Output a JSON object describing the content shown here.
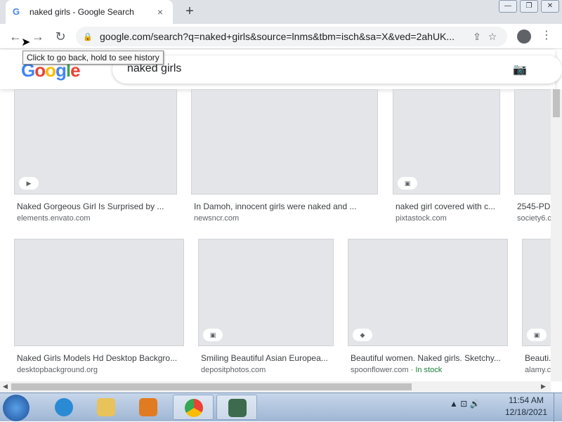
{
  "window": {
    "tab_title": "naked girls - Google Search",
    "tab_favicon": "G",
    "tab_close": "×",
    "new_tab": "+",
    "min": "—",
    "max": "❐",
    "close": "✕"
  },
  "toolbar": {
    "back": "←",
    "forward": "→",
    "reload": "↻",
    "url": "google.com/search?q=naked+girls&source=lnms&tbm=isch&sa=X&ved=2ahUK...",
    "lock": "🔒",
    "share": "⇪",
    "star": "☆",
    "menu": "⋮",
    "tooltip": "Click to go back, hold to see history"
  },
  "search": {
    "logo": [
      "G",
      "o",
      "o",
      "g",
      "l",
      "e"
    ],
    "query": "naked girls",
    "camera": "📷"
  },
  "results": [
    {
      "caption": "Naked Gorgeous Girl Is Surprised by ...",
      "source": "elements.envato.com",
      "badge": "▶"
    },
    {
      "caption": "In Damoh, innocent girls were naked and ...",
      "source": "newsncr.com",
      "badge": ""
    },
    {
      "caption": "naked girl covered with c...",
      "source": "pixtastock.com",
      "badge": "▣"
    },
    {
      "caption": "2545-PD...",
      "source": "society6.c...",
      "badge": ""
    },
    {
      "caption": "Naked Girls Models Hd Desktop Backgro...",
      "source": "desktopbackground.org",
      "badge": ""
    },
    {
      "caption": "Smiling Beautiful Asian Europea...",
      "source": "depositphotos.com",
      "badge": "▣"
    },
    {
      "caption": "Beautiful women. Naked girls. Sketchy...",
      "source": "spoonflower.com",
      "source_extra": " · In stock",
      "badge": "◆"
    },
    {
      "caption": "Beauti...",
      "source": "alamy.c...",
      "badge": "▣"
    }
  ],
  "placeholder_text": "",
  "taskbar": {
    "time": "11:54 AM",
    "date": "12/18/2021",
    "tray_icons": "▲ ⊡ 🔊"
  }
}
